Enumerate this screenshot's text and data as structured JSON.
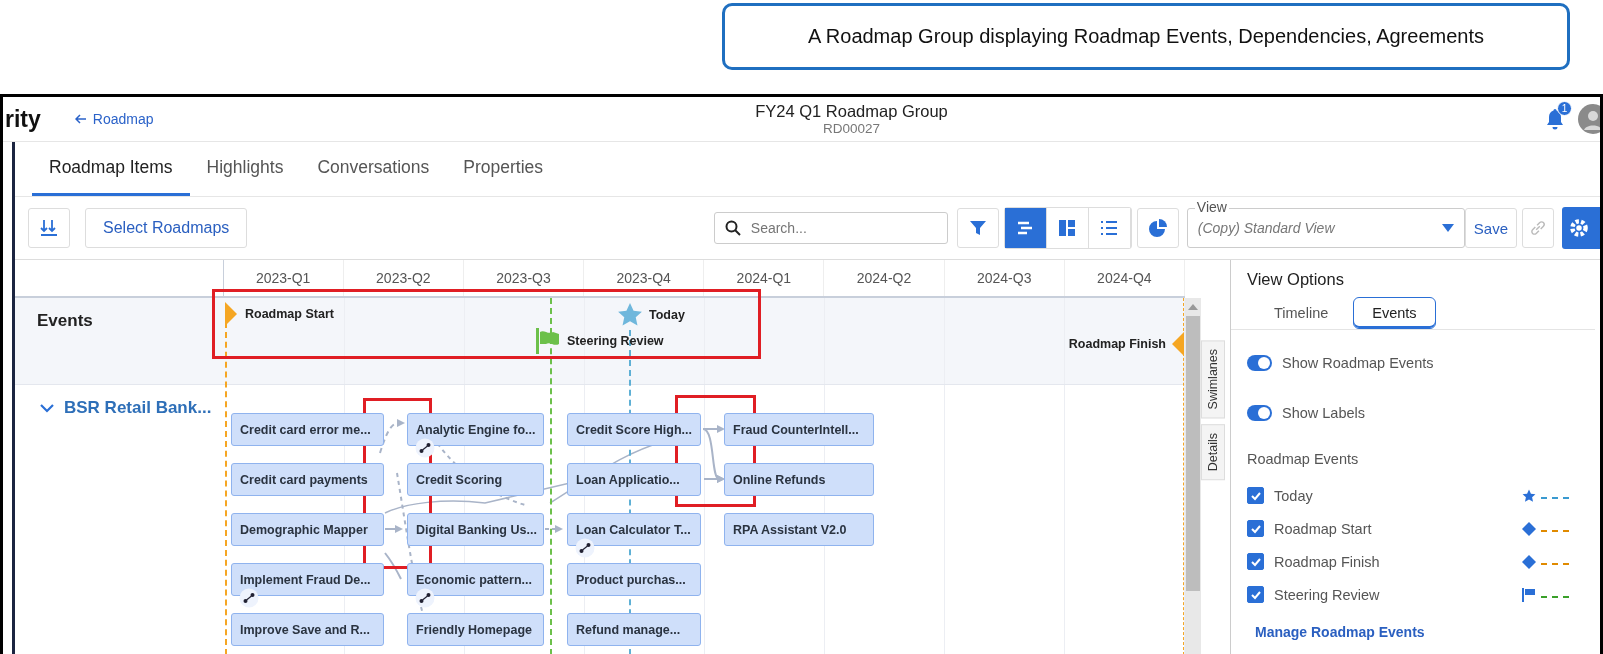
{
  "caption": "A Roadmap Group displaying Roadmap Events, Dependencies, Agreements",
  "header": {
    "logo": "rity",
    "back_link": "Roadmap",
    "title": "FY24 Q1 Roadmap Group",
    "code": "RD00027",
    "notification_count": "1"
  },
  "tabs": [
    {
      "label": "Roadmap Items",
      "selected": true
    },
    {
      "label": "Highlights",
      "selected": false
    },
    {
      "label": "Conversations",
      "selected": false
    },
    {
      "label": "Properties",
      "selected": false
    }
  ],
  "toolbar": {
    "select_button": "Select Roadmaps",
    "search": {
      "placeholder": "Search..."
    },
    "view_modes": [
      {
        "kind": "timeline",
        "selected": true
      },
      {
        "kind": "board",
        "selected": false
      },
      {
        "kind": "list",
        "selected": false
      }
    ],
    "view": {
      "label": "View",
      "value": "(Copy) Standard View"
    },
    "save": "Save",
    "link_disabled": true
  },
  "timeline": {
    "quarters": [
      "2023-Q1",
      "2023-Q2",
      "2023-Q3",
      "2023-Q4",
      "2024-Q1",
      "2024-Q2",
      "2024-Q3",
      "2024-Q4"
    ],
    "events_label": "Events",
    "events": [
      {
        "label": "Roadmap Start",
        "kind": "start"
      },
      {
        "label": "Today",
        "kind": "today"
      },
      {
        "label": "Steering Review",
        "kind": "milestone"
      },
      {
        "label": "Roadmap Finish",
        "kind": "finish"
      }
    ],
    "swimlane": {
      "name": "BSR Retail Bank...",
      "expanded": true,
      "columns": [
        [
          {
            "label": "Credit card error me...",
            "linked": false
          },
          {
            "label": "Credit card payments",
            "linked": false
          },
          {
            "label": "Demographic Mapper",
            "linked": false
          },
          {
            "label": "Implement Fraud De...",
            "linked": true
          },
          {
            "label": "Improve Save and R...",
            "linked": false
          }
        ],
        [
          {
            "label": "Analytic Engine fo...",
            "linked": true
          },
          {
            "label": "Credit Scoring",
            "linked": false
          },
          {
            "label": "Digital Banking Us...",
            "linked": false
          },
          {
            "label": "Economic pattern...",
            "linked": true
          },
          {
            "label": "Friendly Homepage",
            "linked": false
          }
        ],
        [
          {
            "label": "Credit Score High...",
            "linked": false
          },
          {
            "label": "Loan Applicatio...",
            "linked": false
          },
          {
            "label": "Loan Calculator T...",
            "linked": true
          },
          {
            "label": "Product purchas...",
            "linked": false
          },
          {
            "label": "Refund manage...",
            "linked": false
          }
        ],
        [
          {
            "label": "Fraud CounterIntell...",
            "linked": false
          },
          {
            "label": "Online Refunds",
            "linked": false
          },
          {
            "label": "RPA Assistant V2.0",
            "linked": false
          }
        ]
      ]
    }
  },
  "side_tabs": [
    "Swimlanes",
    "Details"
  ],
  "view_options": {
    "title": "View Options",
    "tabs": [
      {
        "label": "Timeline",
        "selected": false
      },
      {
        "label": "Events",
        "selected": true
      }
    ],
    "toggles": [
      {
        "label": "Show Roadmap Events",
        "on": true
      },
      {
        "label": "Show Labels",
        "on": true
      }
    ],
    "events_heading": "Roadmap Events",
    "events": [
      {
        "label": "Today",
        "checked": true,
        "kind": "star",
        "color": "#3a9ad0"
      },
      {
        "label": "Roadmap Start",
        "checked": true,
        "kind": "diamond",
        "color": "#e08a00"
      },
      {
        "label": "Roadmap Finish",
        "checked": true,
        "kind": "diamond",
        "color": "#e08a00"
      },
      {
        "label": "Steering Review",
        "checked": true,
        "kind": "flag",
        "color": "#3aa02a"
      }
    ],
    "manage_link": "Manage Roadmap Events"
  }
}
